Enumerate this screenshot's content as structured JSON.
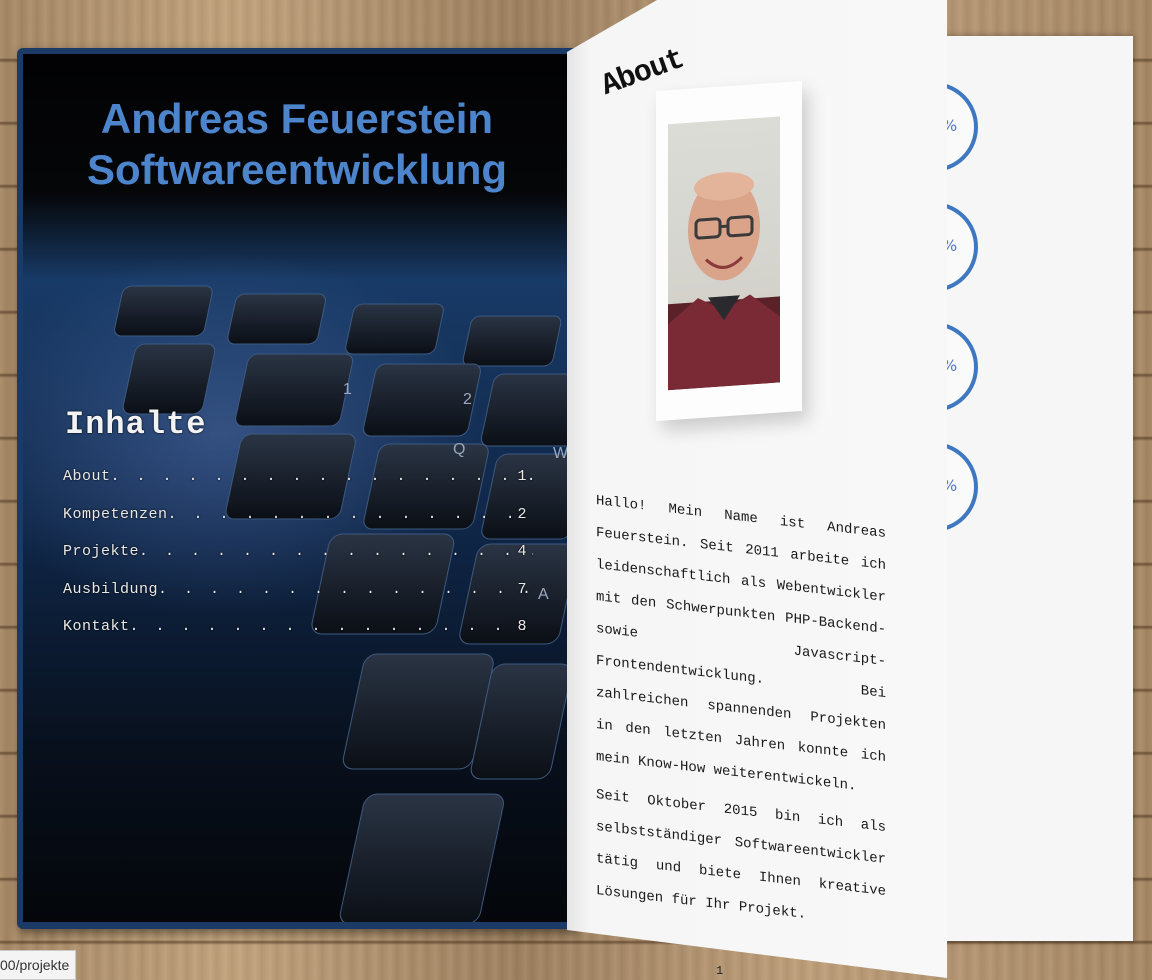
{
  "cover": {
    "title_line1": "Andreas Feuerstein",
    "title_line2": "Softwareentwicklung",
    "toc_heading": "Inhalte",
    "toc": [
      {
        "label": "About",
        "page": "1"
      },
      {
        "label": "Kompetenzen",
        "page": "2"
      },
      {
        "label": "Projekte",
        "page": "4"
      },
      {
        "label": "Ausbildung",
        "page": "7"
      },
      {
        "label": "Kontakt",
        "page": "8"
      }
    ]
  },
  "about": {
    "heading": "About",
    "paragraph1": "Hallo! Mein Name ist Andreas Feuerstein. Seit 2011 arbeite ich leidenschaftlich als Webentwickler mit den Schwerpunkten PHP-Backend- sowie Javascript-Frontendentwicklung. Bei zahlreichen spannenden Projekten in den letzten Jahren konnte ich mein Know-How weiterentwickeln.",
    "paragraph2": "Seit Oktober 2015 bin ich als selbstständiger Softwareentwickler tätig und biete Ihnen kreative Lösungen für Ihr Projekt.",
    "page_number": "1"
  },
  "skills_page": {
    "circles": [
      "%",
      "%",
      "%",
      "%"
    ]
  },
  "status_bar": {
    "url": "00/projekte"
  },
  "colors": {
    "accent_blue": "#4d85cc",
    "cover_border": "#1b3a66"
  }
}
